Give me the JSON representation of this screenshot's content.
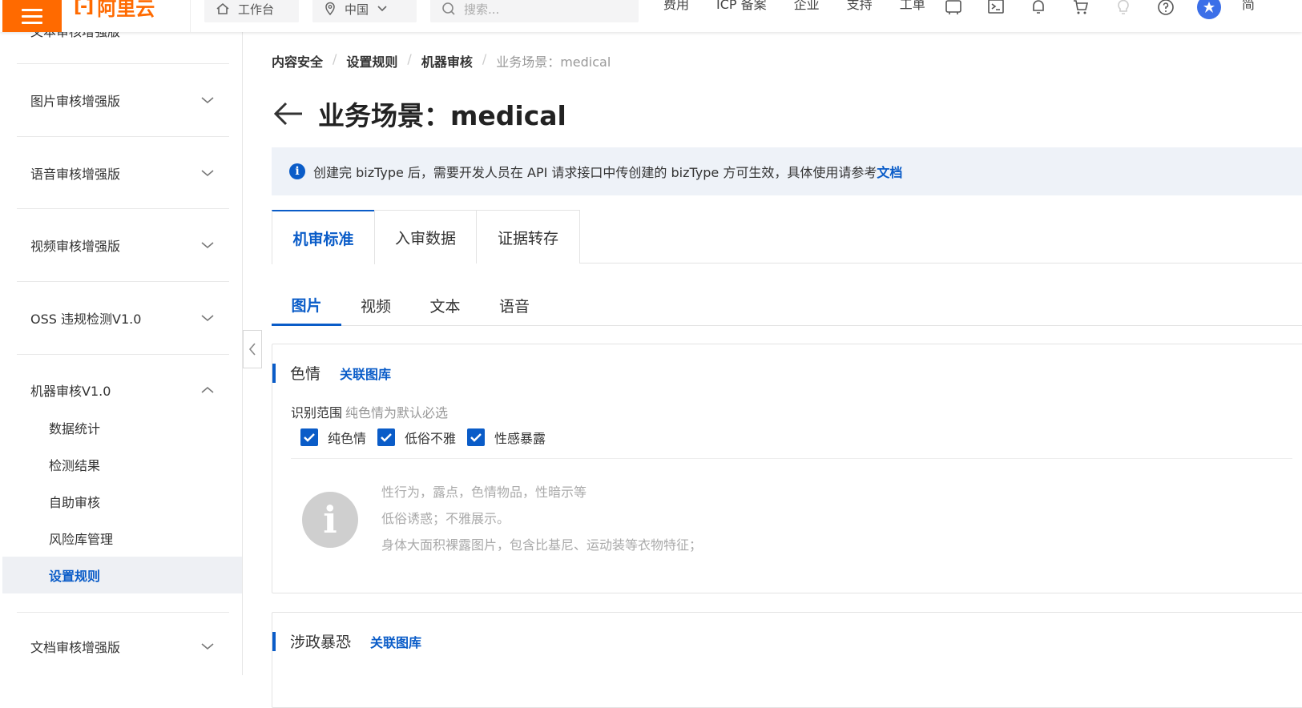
{
  "topbar": {
    "logo_text": "阿里云",
    "logo_mark": "[-]",
    "workbench": "工作台",
    "region": "中国",
    "search_placeholder": "搜索...",
    "nav": [
      "费用",
      "ICP 备案",
      "企业",
      "支持",
      "工单"
    ],
    "more": "简"
  },
  "sidebar": {
    "cut_item": "文本审核增强版",
    "groups": [
      {
        "label": "图片审核增强版"
      },
      {
        "label": "语音审核增强版"
      },
      {
        "label": "视频审核增强版"
      },
      {
        "label": "OSS 违规检测V1.0"
      },
      {
        "label": "机器审核V1.0"
      }
    ],
    "subitems": [
      {
        "label": "数据统计"
      },
      {
        "label": "检测结果"
      },
      {
        "label": "自助审核"
      },
      {
        "label": "风险库管理"
      },
      {
        "label": "设置规则"
      }
    ],
    "bottom_group": "文档审核增强版"
  },
  "breadcrumb": {
    "items": [
      "内容安全",
      "设置规则",
      "机器审核"
    ],
    "last": "业务场景：medical"
  },
  "page": {
    "title": "业务场景：medical"
  },
  "notice": {
    "text": "创建完 bizType 后，需要开发人员在 API 请求接口中传创建的 bizType 方可生效，具体使用请参考",
    "link": "文档"
  },
  "tabs_primary": [
    "机审标准",
    "入审数据",
    "证据转存"
  ],
  "tabs_secondary": [
    "图片",
    "视频",
    "文本",
    "语音"
  ],
  "card1": {
    "title": "色情",
    "link": "关联图库",
    "scope_label": "识别范围",
    "scope_hint": "纯色情为默认必选",
    "checks": [
      "纯色情",
      "低俗不雅",
      "性感暴露"
    ],
    "desc": [
      "性行为，露点，色情物品，性暗示等",
      "低俗诱惑；不雅展示。",
      "身体大面积裸露图片，包含比基尼、运动装等衣物特征；"
    ]
  },
  "card2": {
    "title": "涉政暴恐",
    "link": "关联图库"
  },
  "colors": {
    "brand": "#ff6a00",
    "primary": "#0a5cc8"
  }
}
